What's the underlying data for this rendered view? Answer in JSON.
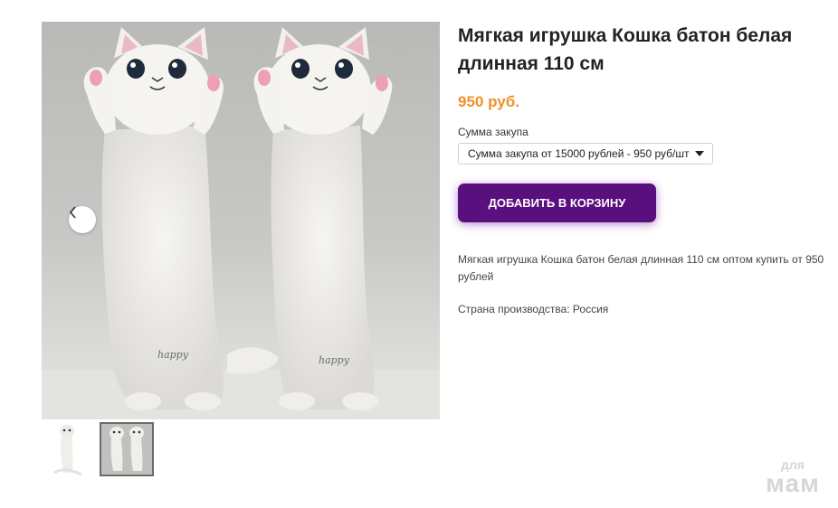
{
  "product": {
    "title": "Мягкая игрушка Кошка батон белая длинная 110 см",
    "price": "950 руб.",
    "select_label": "Сумма закупа",
    "select_value": "Сумма закупа от 15000 рублей - 950 руб/шт",
    "add_to_cart": "ДОБАВИТЬ В КОРЗИНУ",
    "description": "Мягкая игрушка Кошка батон белая длинная 110 см оптом купить от 950 рублей",
    "origin": "Страна производства: Россия"
  },
  "gallery": {
    "thumbnail_count": 2,
    "active_thumbnail": 2,
    "prev_icon": "chevron-left-icon"
  },
  "watermark": {
    "line1": "для",
    "line2": "мам"
  },
  "colors": {
    "price": "#f0902a",
    "button": "#5a0f7e",
    "button_glow": "#8028aa"
  }
}
